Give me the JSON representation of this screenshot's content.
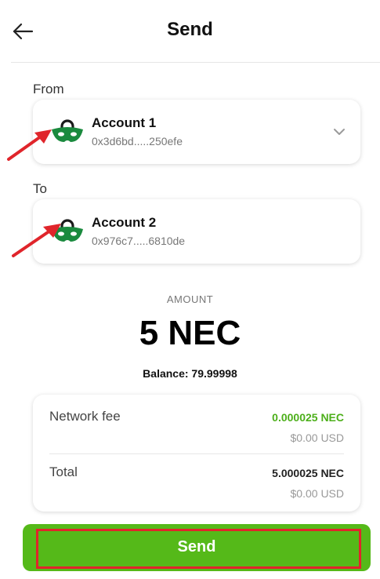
{
  "header": {
    "title": "Send",
    "back_icon": "arrow-left-icon"
  },
  "from": {
    "label": "From",
    "account_name": "Account 1",
    "address": "0x3d6bd.....250efe",
    "logo_icon": "neo-wallet-logo-icon",
    "dropdown_icon": "chevron-down-icon"
  },
  "to": {
    "label": "To",
    "account_name": "Account 2",
    "address": "0x976c7.....6810de",
    "logo_icon": "neo-wallet-logo-icon"
  },
  "amount": {
    "label": "AMOUNT",
    "value": "5 NEC",
    "balance": "Balance: 79.99998"
  },
  "fees": {
    "network_fee_label": "Network fee",
    "network_fee_amount": "0.000025 NEC",
    "network_fee_usd": "$0.00 USD",
    "total_label": "Total",
    "total_amount": "5.000025 NEC",
    "total_usd": "$0.00 USD"
  },
  "send_button": {
    "label": "Send"
  },
  "colors": {
    "accent_green": "#55b919",
    "fee_green": "#4caf1a",
    "annotation_red": "#e0252b",
    "logo_green": "#1a8a3e"
  }
}
